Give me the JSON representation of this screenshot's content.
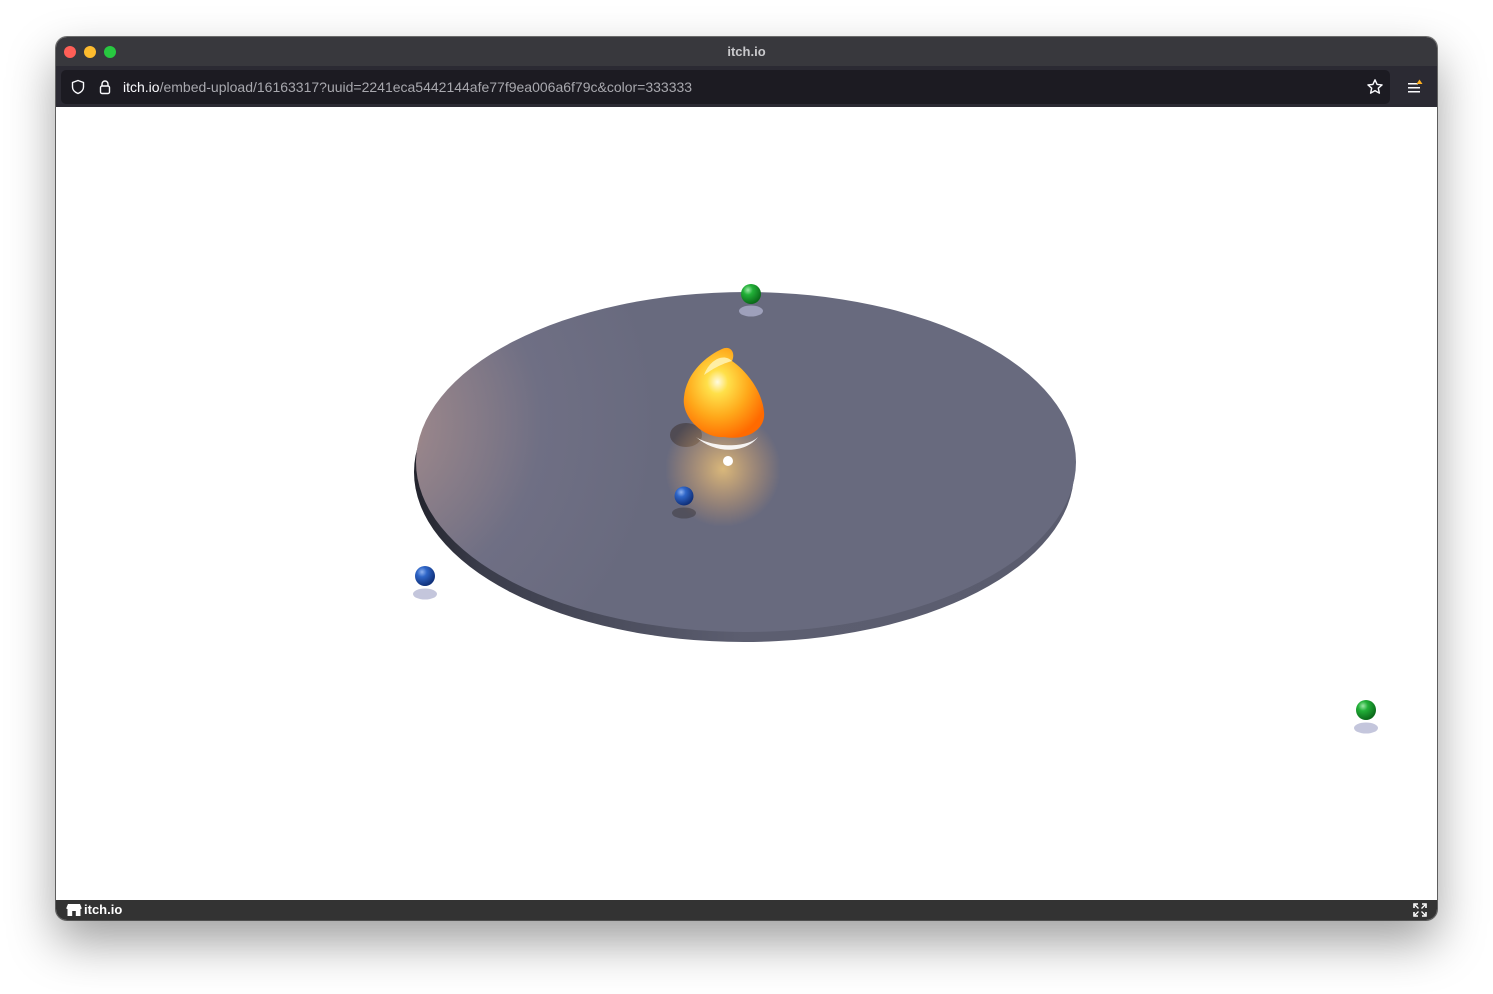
{
  "window": {
    "title": "itch.io"
  },
  "address_bar": {
    "domain": "itch.io",
    "path": "/embed-upload/16163317?uuid=2241eca5442144afe77f9ea006a6f79c&color=333333"
  },
  "icons": {
    "shield": "shield-icon",
    "lock": "lock-icon",
    "star": "star-icon",
    "menu": "menu-icon",
    "footer_logo": "itchio-logo-icon",
    "fullscreen": "fullscreen-icon"
  },
  "footer": {
    "brand": "itch.io",
    "background": "#333333"
  },
  "game_scene": {
    "platform_color": "#6a6c80",
    "sun_color": "#ffb020",
    "blue_planet_color": "#1f55b0",
    "green_planet_color": "#20a030"
  }
}
